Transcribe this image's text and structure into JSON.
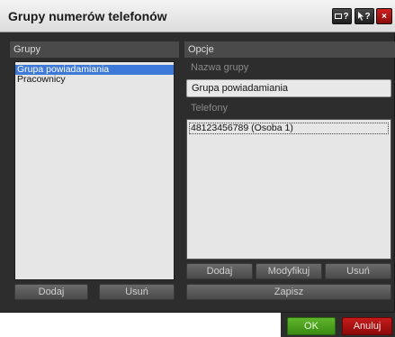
{
  "window": {
    "title": "Grupy numerów telefonów"
  },
  "title_buttons": {
    "help_window": "?",
    "help_pointer": "?",
    "close": "×"
  },
  "groups_panel": {
    "header": "Grupy",
    "items": [
      "Grupa powiadamiania",
      "Pracownicy"
    ],
    "selected_index": 0,
    "add_label": "Dodaj",
    "remove_label": "Usuń"
  },
  "options_panel": {
    "header": "Opcje",
    "group_name_label": "Nazwa grupy",
    "group_name_value": "Grupa powiadamiania",
    "phones_label": "Telefony",
    "phones": [
      "48123456789 (Osoba 1)"
    ],
    "add_label": "Dodaj",
    "modify_label": "Modyfikuj",
    "remove_label": "Usuń",
    "save_label": "Zapisz"
  },
  "dialog": {
    "ok_label": "OK",
    "cancel_label": "Anuluj"
  }
}
